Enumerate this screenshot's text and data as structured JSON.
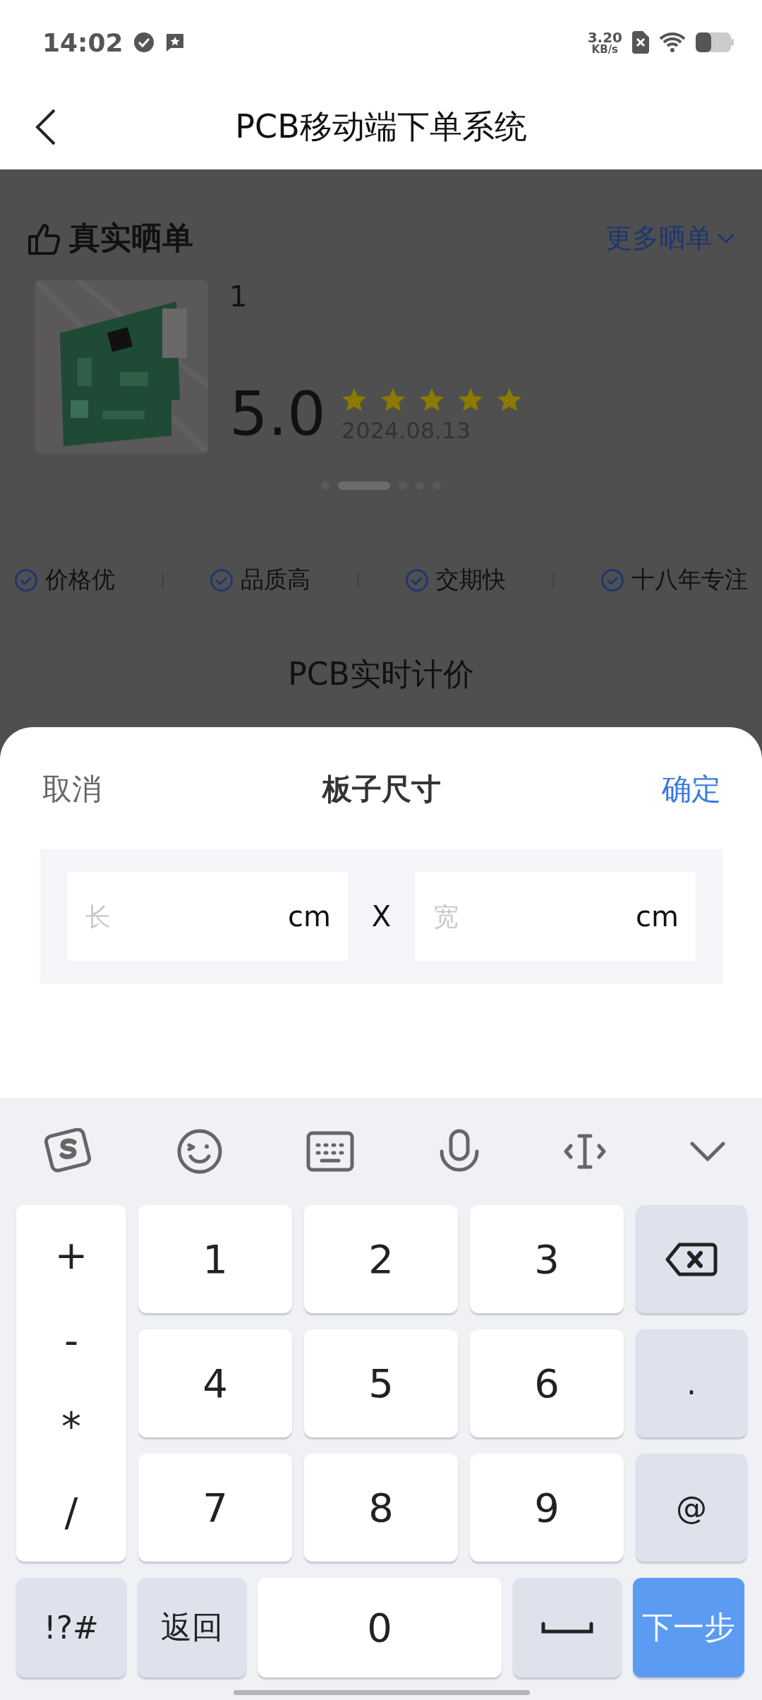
{
  "status_bar": {
    "time": "14:02",
    "speed_value": "3.20",
    "speed_unit": "KB/s"
  },
  "nav": {
    "title": "PCB移动端下单系统"
  },
  "reviews": {
    "title": "真实晒单",
    "more": "更多晒单",
    "item": {
      "kind": "picture",
      "text": "1",
      "score": "5.0",
      "stars": 5,
      "date": "2024.08.13"
    },
    "dots": [
      {
        "selected": false
      },
      {
        "selected": true
      },
      {
        "selected": false
      },
      {
        "selected": false
      },
      {
        "selected": false
      }
    ]
  },
  "features": [
    "价格优",
    "品质高",
    "交期快",
    "十八年专注"
  ],
  "section_title": "PCB实时计价",
  "sheet": {
    "cancel": "取消",
    "title": "板子尺寸",
    "confirm": "确定",
    "separator": "X",
    "fields": [
      {
        "placeholder": "长",
        "unit": "cm"
      },
      {
        "placeholder": "宽",
        "unit": "cm"
      }
    ]
  },
  "keyboard": {
    "side_keys": [
      "+",
      "-",
      "*",
      "/"
    ],
    "rows": [
      [
        "1",
        "2",
        "3"
      ],
      [
        "4",
        "5",
        "6"
      ],
      [
        "7",
        "8",
        "9"
      ]
    ],
    "right_keys": [
      {
        "kind": "backspace"
      },
      {
        "kind": "char",
        "label": "."
      },
      {
        "kind": "char",
        "label": "@"
      }
    ],
    "bottom_keys": [
      {
        "kind": "char",
        "label": "!?#"
      },
      {
        "kind": "char",
        "label": "返回"
      },
      {
        "kind": "main",
        "label": "0"
      },
      {
        "kind": "space"
      },
      {
        "kind": "primary",
        "label": "下一步"
      }
    ]
  }
}
